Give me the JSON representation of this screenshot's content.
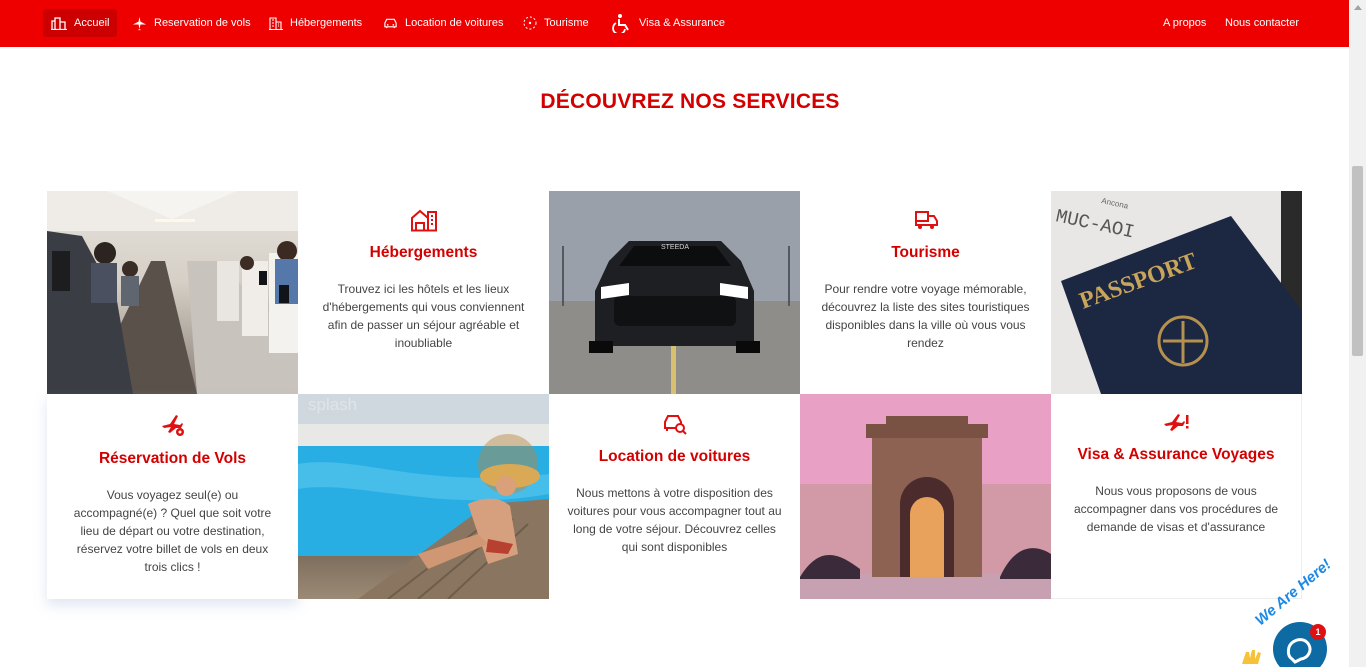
{
  "nav": {
    "items": [
      {
        "label": "Accueil",
        "icon": "home-icon"
      },
      {
        "label": "Reservation de vols",
        "icon": "plane-icon"
      },
      {
        "label": "Hébergements",
        "icon": "building-icon"
      },
      {
        "label": "Location de voitures",
        "icon": "car-icon"
      },
      {
        "label": "Tourisme",
        "icon": "compass-icon"
      },
      {
        "label": "Visa & Assurance",
        "icon": "wheelchair-icon"
      }
    ],
    "right_items": [
      {
        "label": "A propos"
      },
      {
        "label": "Nous contacter"
      }
    ]
  },
  "section": {
    "title": "DÉCOUVREZ NOS SERVICES"
  },
  "services": {
    "hebergements": {
      "title": "Hébergements",
      "description": "Trouvez ici les hôtels et les lieux d'hébergements qui vous conviennent afin de passer un séjour agréable et inoubliable",
      "icon": "hotel-icon"
    },
    "tourisme": {
      "title": "Tourisme",
      "description": "Pour rendre votre voyage mémorable, découvrez la liste des sites touristiques disponibles dans la ville où vous vous rendez",
      "icon": "bus-icon"
    },
    "vols": {
      "title": "Réservation de Vols",
      "description": "Vous voyagez seul(e) ou accompagné(e) ? Quel que soit votre lieu de départ ou votre destination, réservez votre billet de vols en deux trois clics !",
      "icon": "plane-pin-icon"
    },
    "voitures": {
      "title": "Location de voitures",
      "description": "Nous mettons à votre disposition des voitures pour vous accompagner tout au long de votre séjour. Découvrez celles qui sont disponibles",
      "icon": "car-search-icon"
    },
    "visa": {
      "title": "Visa & Assurance Voyages",
      "description": "Nous vous proposons de vous accompagner dans vos procédures de demande de visas et d'assurance",
      "icon": "plane-alert-icon"
    }
  },
  "images": {
    "passport_text": "PASSPORT",
    "passport_code": "MUC-AOI",
    "passport_city": "Ancona",
    "car_plate": "STEEDA",
    "pool_watermark": "splash"
  },
  "chat": {
    "label": "We Are Here!",
    "badge": "1"
  },
  "colors": {
    "brand_red": "#ee0000",
    "title_red": "#d40000",
    "chat_blue": "#0d6aa3"
  }
}
